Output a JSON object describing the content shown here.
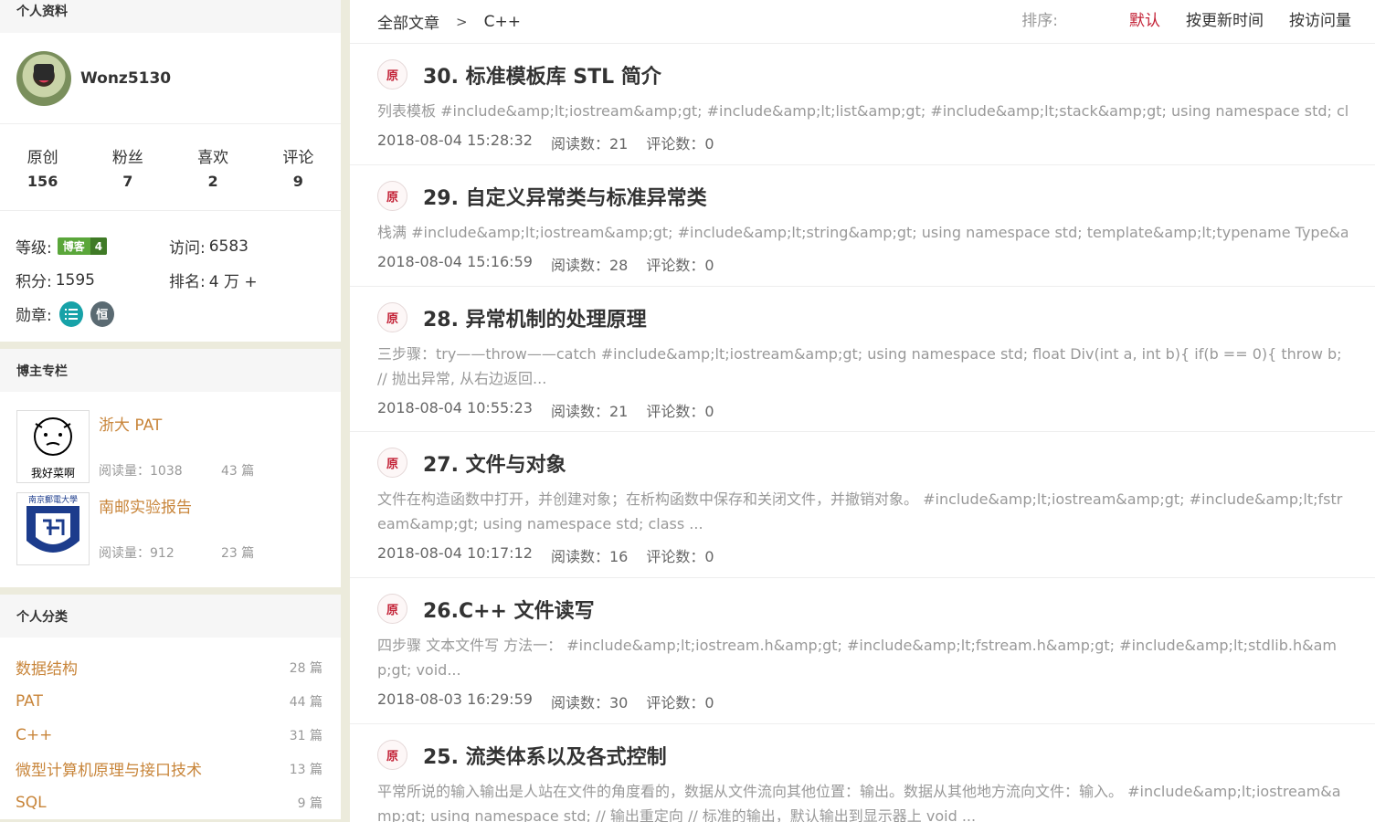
{
  "profile": {
    "header": "个人资料",
    "username": "Wonz5130",
    "stats": [
      {
        "label": "原创",
        "value": "156"
      },
      {
        "label": "粉丝",
        "value": "7"
      },
      {
        "label": "喜欢",
        "value": "2"
      },
      {
        "label": "评论",
        "value": "9"
      }
    ],
    "level_label": "等级:",
    "level_badge_text": "博客",
    "level_badge_num": "4",
    "visits_label": "访问:",
    "visits_value": "6583",
    "points_label": "积分:",
    "points_value": "1595",
    "rank_label": "排名:",
    "rank_value": "4 万 +",
    "medals_label": "勋章:",
    "medal_heng": "恒"
  },
  "columns": {
    "header": "博主专栏",
    "items": [
      {
        "title": "浙大 PAT",
        "reads": "阅读量：1038",
        "count": "43 篇",
        "thumb_text": "我好菜啊"
      },
      {
        "title": "南邮实验报告",
        "reads": "阅读量：912",
        "count": "23 篇",
        "thumb_text": "南京郵電大學"
      }
    ]
  },
  "categories": {
    "header": "个人分类",
    "items": [
      {
        "name": "数据结构",
        "count": "28 篇"
      },
      {
        "name": "PAT",
        "count": "44 篇"
      },
      {
        "name": "C++",
        "count": "31 篇"
      },
      {
        "name": "微型计算机原理与接口技术",
        "count": "13 篇"
      },
      {
        "name": "SQL",
        "count": "9 篇"
      }
    ]
  },
  "breadcrumb": {
    "root": "全部文章",
    "sep": ">",
    "current": "C++"
  },
  "sort": {
    "label": "排序:",
    "options": [
      "默认",
      "按更新时间",
      "按访问量"
    ],
    "active": "默认"
  },
  "articles": [
    {
      "badge": "原",
      "title": "30. 标准模板库 STL 简介",
      "summary": "列表模板 #include&amp;lt;iostream&amp;gt; #include&amp;lt;list&amp;gt; #include&amp;lt;stack&amp;gt; using namespace std; clas...",
      "date": "2018-08-04 15:28:32",
      "reads": "阅读数：21",
      "comments": "评论数：0"
    },
    {
      "badge": "原",
      "title": "29. 自定义异常类与标准异常类",
      "summary": "栈满 #include&amp;lt;iostream&amp;gt; #include&amp;lt;string&amp;gt; using namespace std; template&amp;lt;typename Type&amp;...",
      "date": "2018-08-04 15:16:59",
      "reads": "阅读数：28",
      "comments": "评论数：0"
    },
    {
      "badge": "原",
      "title": "28. 异常机制的处理原理",
      "summary": "三步骤：try——throw——catch #include&amp;lt;iostream&amp;gt; using namespace std; float Div(int a, int b){ if(b == 0){ throw b; // 抛出异常, 从右边返回...",
      "date": "2018-08-04 10:55:23",
      "reads": "阅读数：21",
      "comments": "评论数：0"
    },
    {
      "badge": "原",
      "title": "27. 文件与对象",
      "summary": "文件在构造函数中打开，并创建对象；在析构函数中保存和关闭文件，并撤销对象。 #include&amp;lt;iostream&amp;gt; #include&amp;lt;fstream&amp;gt; using namespace std; class ...",
      "date": "2018-08-04 10:17:12",
      "reads": "阅读数：16",
      "comments": "评论数：0"
    },
    {
      "badge": "原",
      "title": "26.C++ 文件读写",
      "summary": "四步骤 文本文件写 方法一： #include&amp;lt;iostream.h&amp;gt; #include&amp;lt;fstream.h&amp;gt; #include&amp;lt;stdlib.h&amp;gt; void...",
      "date": "2018-08-03 16:29:59",
      "reads": "阅读数：30",
      "comments": "评论数：0"
    },
    {
      "badge": "原",
      "title": "25. 流类体系以及各式控制",
      "summary": "平常所说的输入输出是人站在文件的角度看的，数据从文件流向其他位置：输出。数据从其他地方流向文件：输入。 #include&amp;lt;iostream&amp;gt; using namespace std; // 输出重定向 // 标准的输出，默认输出到显示器上 void ...",
      "date": "",
      "reads": "",
      "comments": ""
    }
  ]
}
